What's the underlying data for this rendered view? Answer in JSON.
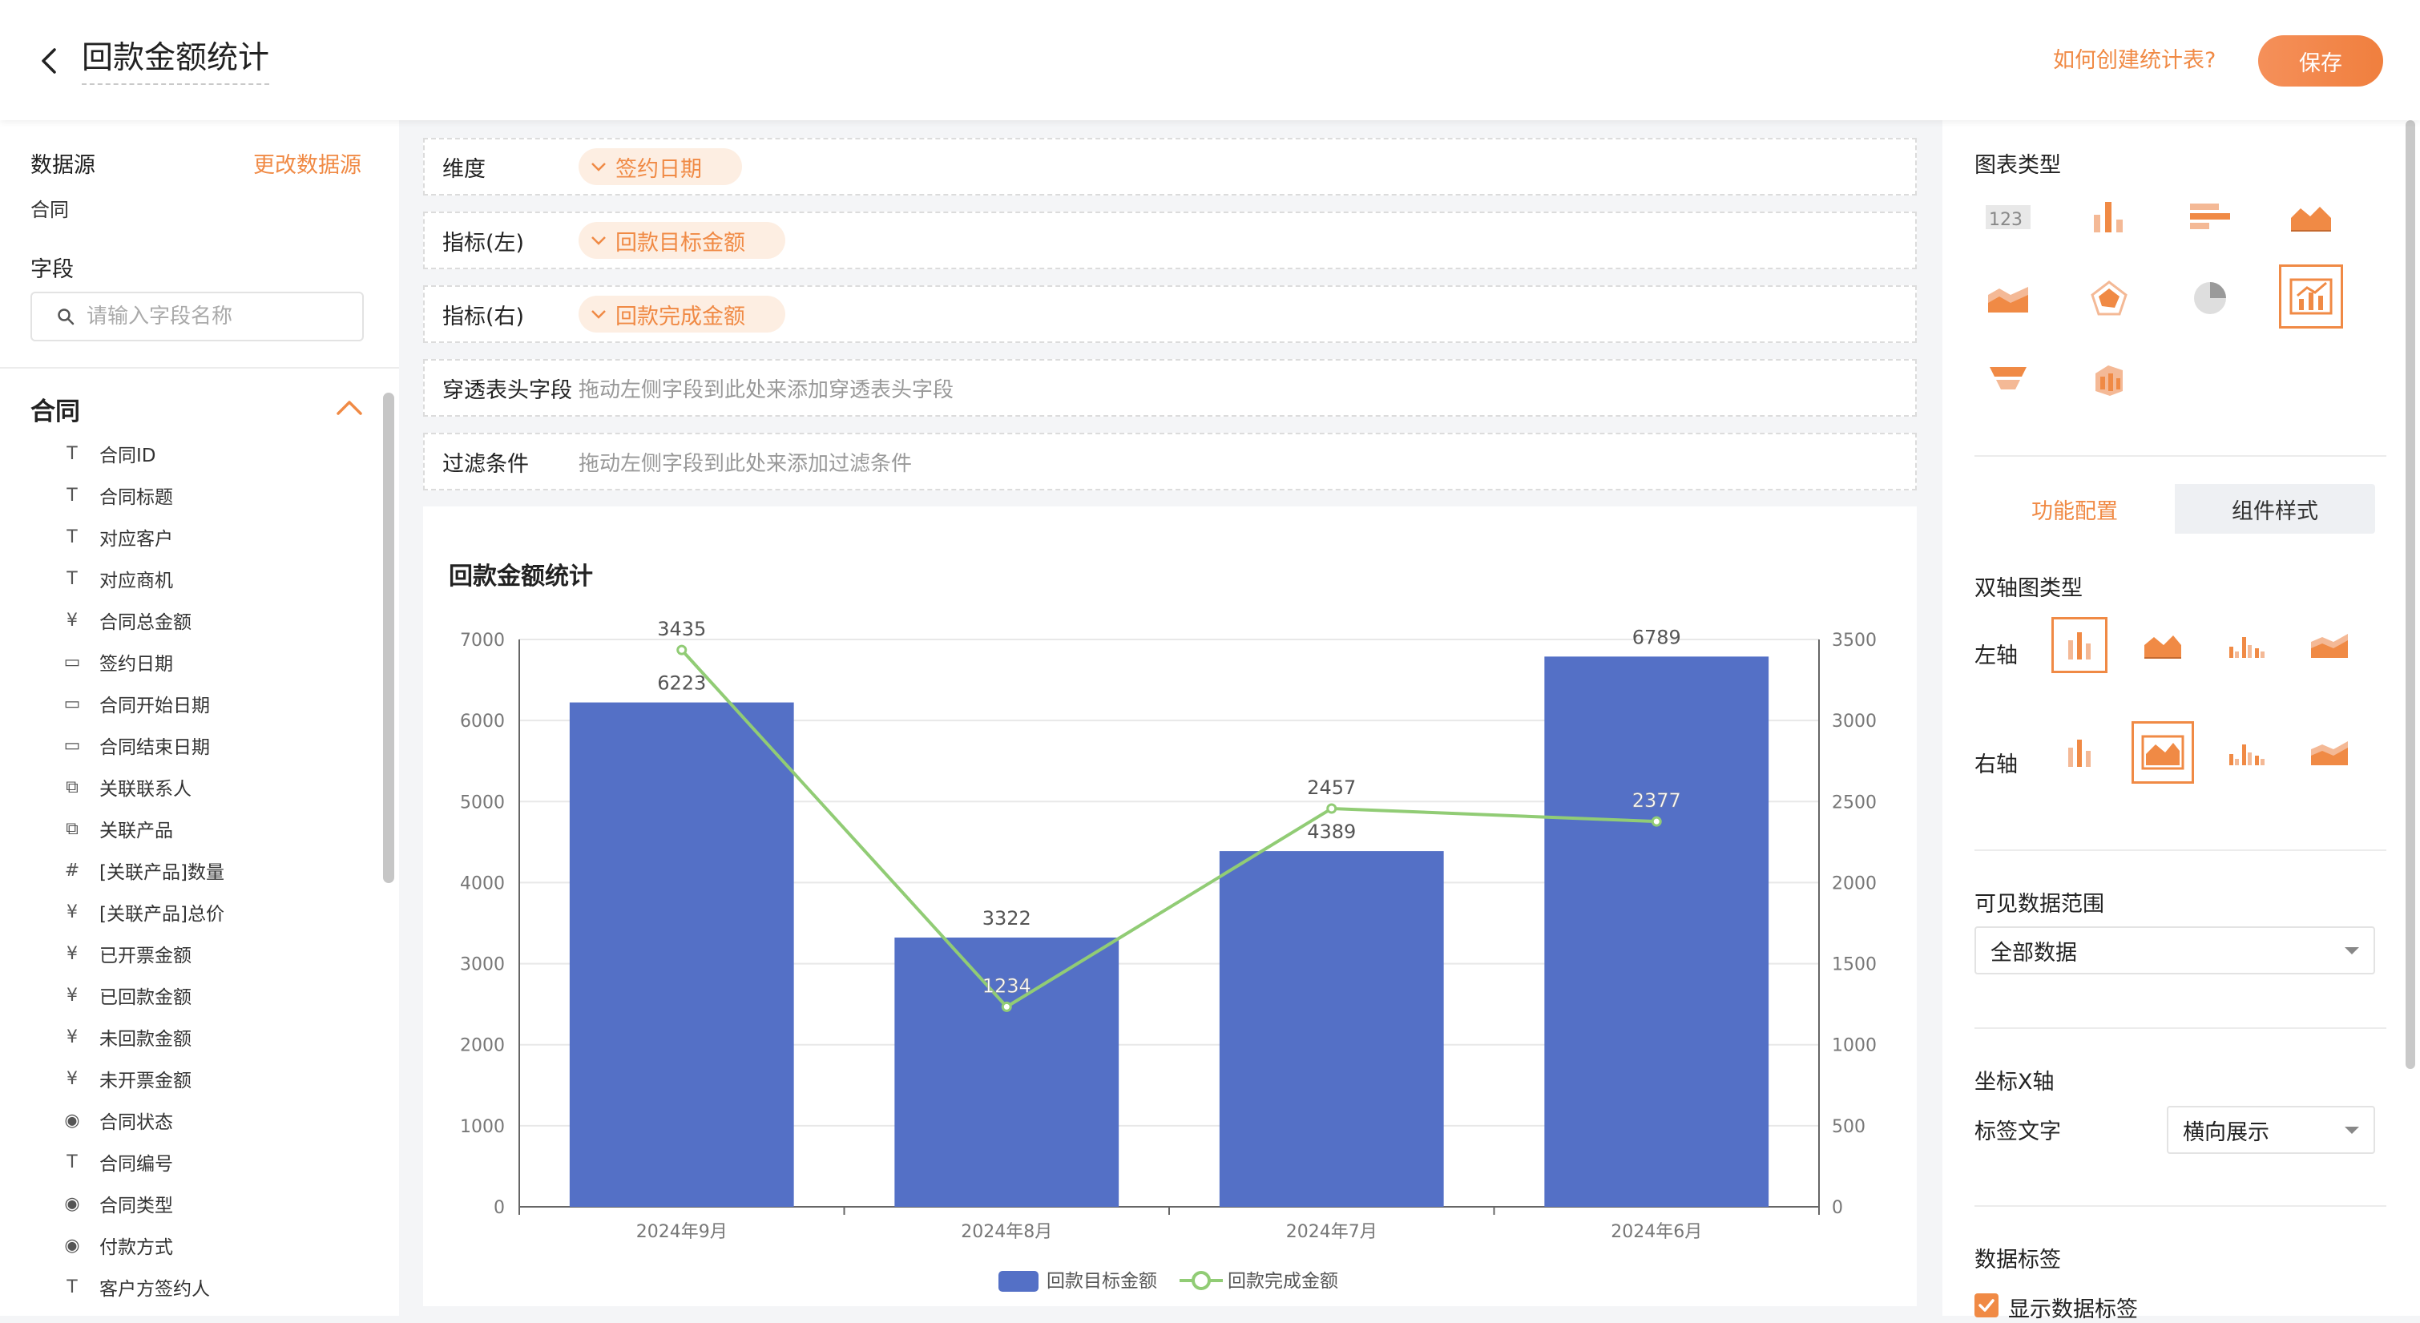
{
  "header": {
    "title": "回款金额统计",
    "help_link": "如何创建统计表?",
    "save_label": "保存"
  },
  "datasource": {
    "label": "数据源",
    "change_link": "更改数据源",
    "value": "合同"
  },
  "fields": {
    "label": "字段",
    "search_placeholder": "请输入字段名称",
    "group_name": "合同",
    "items": [
      {
        "icon": "T",
        "label": "合同ID"
      },
      {
        "icon": "T",
        "label": "合同标题"
      },
      {
        "icon": "T",
        "label": "对应客户"
      },
      {
        "icon": "T",
        "label": "对应商机"
      },
      {
        "icon": "¥",
        "label": "合同总金额"
      },
      {
        "icon": "▭",
        "label": "签约日期"
      },
      {
        "icon": "▭",
        "label": "合同开始日期"
      },
      {
        "icon": "▭",
        "label": "合同结束日期"
      },
      {
        "icon": "⧉",
        "label": "关联联系人"
      },
      {
        "icon": "⧉",
        "label": "关联产品"
      },
      {
        "icon": "#",
        "label": "[关联产品]数量"
      },
      {
        "icon": "¥",
        "label": "[关联产品]总价"
      },
      {
        "icon": "¥",
        "label": "已开票金额"
      },
      {
        "icon": "¥",
        "label": "已回款金额"
      },
      {
        "icon": "¥",
        "label": "未回款金额"
      },
      {
        "icon": "¥",
        "label": "未开票金额"
      },
      {
        "icon": "◉",
        "label": "合同状态"
      },
      {
        "icon": "T",
        "label": "合同编号"
      },
      {
        "icon": "◉",
        "label": "合同类型"
      },
      {
        "icon": "◉",
        "label": "付款方式"
      },
      {
        "icon": "T",
        "label": "客户方签约人"
      }
    ]
  },
  "config": {
    "dimension": {
      "label": "维度",
      "value": "签约日期"
    },
    "metric_left": {
      "label": "指标(左)",
      "value": "回款目标金额"
    },
    "metric_right": {
      "label": "指标(右)",
      "value": "回款完成金额"
    },
    "drill": {
      "label": "穿透表头字段",
      "hint": "拖动左侧字段到此处来添加穿透表头字段"
    },
    "filter": {
      "label": "过滤条件",
      "hint": "拖动左侧字段到此处来添加过滤条件"
    }
  },
  "chart_data": {
    "type": "bar",
    "title": "回款金额统计",
    "categories": [
      "2024年9月",
      "2024年8月",
      "2024年7月",
      "2024年6月"
    ],
    "series": [
      {
        "name": "回款目标金额",
        "type": "bar",
        "axis": "left",
        "values": [
          6223,
          3322,
          4389,
          6789
        ],
        "color": "#5470c6"
      },
      {
        "name": "回款完成金额",
        "type": "line",
        "axis": "right",
        "values": [
          3435,
          1234,
          2457,
          2377
        ],
        "color": "#91cc75"
      }
    ],
    "y_left": {
      "min": 0,
      "max": 7000,
      "ticks": [
        "0",
        "1000",
        "2000",
        "3000",
        "4000",
        "5000",
        "6000",
        "7000"
      ]
    },
    "y_right": {
      "min": 0,
      "max": 3500,
      "ticks": [
        "0",
        "500",
        "1000",
        "1500",
        "2000",
        "2500",
        "3000",
        "3500"
      ]
    },
    "legend_position": "bottom-center",
    "grid": true
  },
  "right_panel": {
    "chart_type_label": "图表类型",
    "chart_types": [
      "number-card-icon",
      "bar-chart-icon",
      "horizontal-bar-icon",
      "area-chart-icon",
      "stacked-area-icon",
      "radar-chart-icon",
      "pie-chart-icon",
      "dual-axis-chart-icon",
      "funnel-chart-icon",
      "map-chart-icon"
    ],
    "active_chart_type": "dual-axis-chart-icon",
    "tabs": [
      "功能配置",
      "组件样式"
    ],
    "active_tab": "功能配置",
    "dual_axis_label": "双轴图类型",
    "left_axis_label": "左轴",
    "right_axis_label": "右轴",
    "visible_range_label": "可见数据范围",
    "visible_range_value": "全部数据",
    "x_axis_label": "坐标X轴",
    "tick_text_label": "标签文字",
    "tick_text_value": "横向展示",
    "data_label_section": "数据标签",
    "show_data_label": "显示数据标签",
    "accent_color": "#f08a45"
  }
}
